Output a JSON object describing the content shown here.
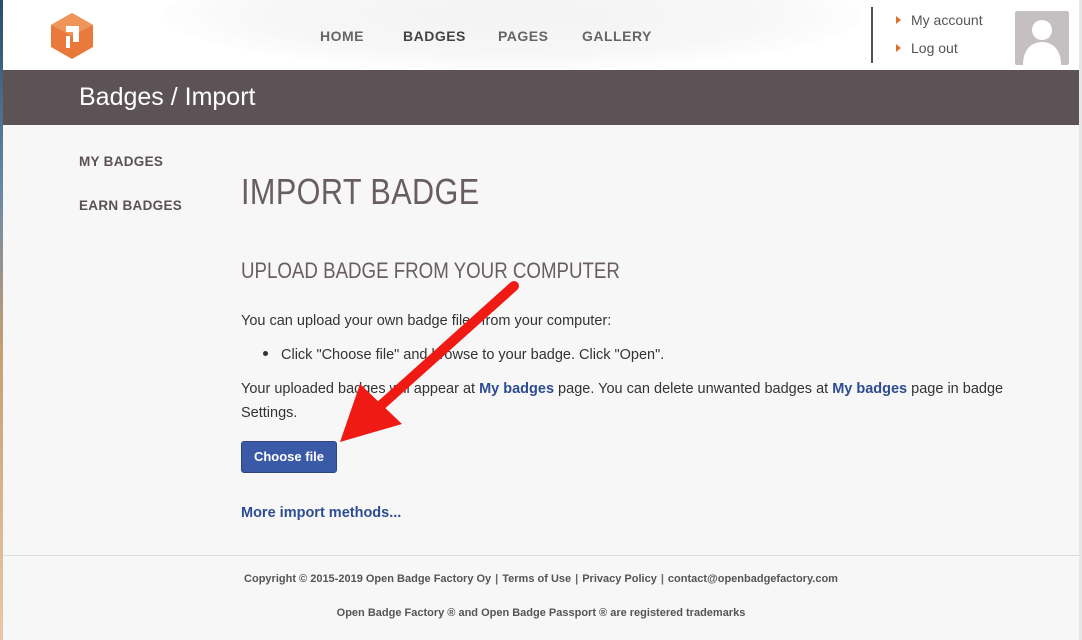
{
  "header": {
    "nav": [
      {
        "label": "HOME"
      },
      {
        "label": "BADGES"
      },
      {
        "label": "PAGES"
      },
      {
        "label": "GALLERY"
      }
    ],
    "account_links": [
      {
        "label": "My account"
      },
      {
        "label": "Log out"
      }
    ]
  },
  "titlebar": {
    "title": "Badges / Import"
  },
  "sidebar": {
    "items": [
      {
        "label": "MY BADGES"
      },
      {
        "label": "EARN BADGES"
      }
    ]
  },
  "main": {
    "heading": "IMPORT BADGE",
    "subheading": "UPLOAD BADGE FROM YOUR COMPUTER",
    "intro": "You can upload your own badge files from your computer:",
    "bullet": "Click \"Choose file\" and browse to your badge. Click \"Open\".",
    "info_part1": "Your uploaded badges will appear at ",
    "info_link1": "My badges",
    "info_part2": " page. You can delete unwanted badges at ",
    "info_link2": "My badges",
    "info_part3": " page in badge",
    "info_part4": "Settings.",
    "choose_button": "Choose file",
    "more_link": "More import methods..."
  },
  "footer": {
    "copyright": "Copyright © 2015-2019 Open Badge Factory Oy",
    "terms": "Terms of Use",
    "privacy": "Privacy Policy",
    "contact": "contact@openbadgefactory.com",
    "trademarks": "Open Badge Factory ® and Open Badge Passport ® are registered trademarks"
  },
  "colors": {
    "accent": "#3a59a6",
    "link": "#2e4c91",
    "titlebar_bg": "#5d5357",
    "logo_orange": "#e8793a",
    "annotation_arrow": "#f01a14"
  },
  "icons": {
    "logo": "open-badge-factory-logo",
    "avatar": "user-avatar-placeholder",
    "caret": "caret-right-icon"
  }
}
